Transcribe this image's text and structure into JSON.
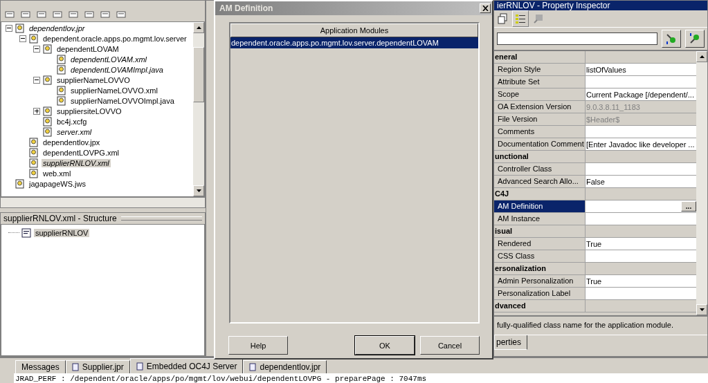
{
  "navigator": {
    "tree": [
      {
        "label": "dependentlov.jpr",
        "open": true,
        "selected": false,
        "expanded": true,
        "children": [
          {
            "label": "dependent.oracle.apps.po.mgmt.lov.server",
            "open": false,
            "selected": false,
            "expanded": true,
            "children": [
              {
                "label": "dependentLOVAM",
                "open": false,
                "selected": false,
                "expanded": true,
                "children": [
                  {
                    "label": "dependentLOVAM.xml",
                    "open": true,
                    "selected": false
                  },
                  {
                    "label": "dependentLOVAMImpl.java",
                    "open": true,
                    "selected": false
                  }
                ]
              },
              {
                "label": "supplierNameLOVVO",
                "open": false,
                "selected": false,
                "expanded": true,
                "children": [
                  {
                    "label": "supplierNameLOVVO.xml",
                    "open": false,
                    "selected": false
                  },
                  {
                    "label": "supplierNameLOVVOImpl.java",
                    "open": false,
                    "selected": false
                  }
                ]
              },
              {
                "label": "suppliersiteLOVVO",
                "open": false,
                "selected": false,
                "expanded": false
              },
              {
                "label": "bc4j.xcfg",
                "open": false,
                "selected": false
              },
              {
                "label": "server.xml",
                "open": true,
                "selected": false
              }
            ]
          },
          {
            "label": "dependentlov.jpx",
            "open": false,
            "selected": false
          },
          {
            "label": "dependentLOVPG.xml",
            "open": false,
            "selected": false
          },
          {
            "label": "supplierRNLOV.xml",
            "open": true,
            "selected": true
          },
          {
            "label": "web.xml",
            "open": false,
            "selected": false
          }
        ]
      },
      {
        "label": "jagapageWS.jws",
        "open": false,
        "selected": false
      }
    ]
  },
  "structure": {
    "title": "supplierRNLOV.xml - Structure",
    "tree": [
      {
        "label": "supplierRNLOV",
        "selected": true
      }
    ]
  },
  "inspector": {
    "title": "ierRNLOV - Property Inspector",
    "rows": [
      {
        "kind": "category",
        "label": "eneral"
      },
      {
        "kind": "property",
        "label": "Region Style",
        "value": "listOfValues",
        "readonly": false,
        "selected": false
      },
      {
        "kind": "property",
        "label": "Attribute Set",
        "readonly": false,
        "selected": false
      },
      {
        "kind": "property",
        "label": "Scope",
        "value": "Current Package [/dependent/...",
        "readonly": false,
        "selected": false
      },
      {
        "kind": "property",
        "label": "OA Extension Version",
        "value": "9.0.3.8.11_1183",
        "readonly": true,
        "selected": false
      },
      {
        "kind": "property",
        "label": "File Version",
        "value": "$Header$",
        "readonly": true,
        "selected": false
      },
      {
        "kind": "property",
        "label": "Comments",
        "readonly": false,
        "selected": false
      },
      {
        "kind": "property",
        "label": "Documentation Comment",
        "value": "[Enter Javadoc like developer ...",
        "readonly": false,
        "selected": false
      },
      {
        "kind": "category",
        "label": "unctional"
      },
      {
        "kind": "property",
        "label": "Controller Class",
        "readonly": false,
        "selected": false
      },
      {
        "kind": "property",
        "label": "Advanced Search Allo...",
        "value": "False",
        "readonly": false,
        "selected": false
      },
      {
        "kind": "category",
        "label": "C4J"
      },
      {
        "kind": "property",
        "label": "AM Definition",
        "readonly": false,
        "selected": true,
        "button": "..."
      },
      {
        "kind": "property",
        "label": "AM Instance",
        "readonly": false,
        "selected": false
      },
      {
        "kind": "category",
        "label": "isual"
      },
      {
        "kind": "property",
        "label": "Rendered",
        "value": "True",
        "readonly": false,
        "selected": false
      },
      {
        "kind": "property",
        "label": "CSS Class",
        "readonly": false,
        "selected": false
      },
      {
        "kind": "category",
        "label": "ersonalization"
      },
      {
        "kind": "property",
        "label": "Admin Personalization",
        "value": "True",
        "readonly": false,
        "selected": false
      },
      {
        "kind": "property",
        "label": "Personalization Label",
        "readonly": false,
        "selected": false
      },
      {
        "kind": "category",
        "label": "dvanced"
      }
    ],
    "description": "fully-qualified class name for the application module.",
    "tab": "perties"
  },
  "log": {
    "tabs": [
      {
        "label": "Messages",
        "selected": false
      },
      {
        "label": "Supplier.jpr",
        "selected": false
      },
      {
        "label": "Embedded OC4J Server",
        "selected": true
      },
      {
        "label": "dependentlov.jpr",
        "selected": false
      }
    ],
    "line": "JRAD_PERF : /dependent/oracle/apps/po/mgmt/lov/webui/dependentLOVPG - preparePage : 7047ms"
  },
  "dialog": {
    "title": "AM Definition",
    "column": "Application Modules",
    "rows": [
      {
        "label": "dependent.oracle.apps.po.mgmt.lov.server.dependentLOVAM",
        "selected": true
      }
    ],
    "buttons": [
      {
        "label": "Help"
      },
      {
        "label": "OK",
        "default": true
      },
      {
        "label": "Cancel"
      }
    ]
  }
}
